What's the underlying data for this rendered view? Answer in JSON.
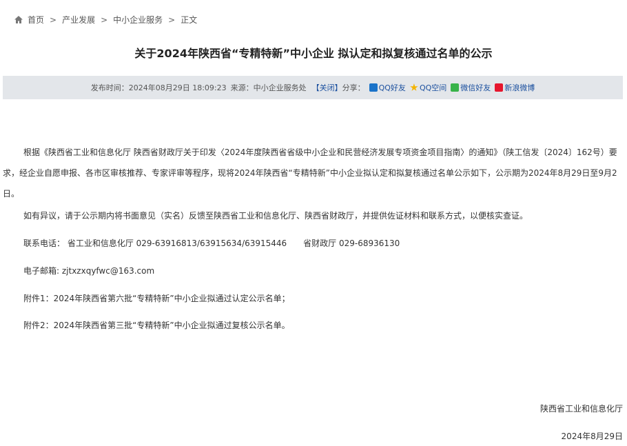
{
  "breadcrumb": {
    "items": [
      "首页",
      "产业发展",
      "中小企业服务",
      "正文"
    ],
    "separator": ">"
  },
  "title": "关于2024年陕西省“专精特新”中小企业 拟认定和拟复核通过名单的公示",
  "info": {
    "publish_label": "发布时间：",
    "publish_time": "2024年08月29日 18:09:23",
    "source_label": "来源：",
    "source": "中小企业服务处",
    "close_label": "【关闭】",
    "share_label": "分享：",
    "share": [
      "QQ好友",
      "QQ空间",
      "微信好友",
      "新浪微博"
    ]
  },
  "body": {
    "para1": "根据《陕西省工业和信息化厅 陕西省财政厅关于印发〈2024年度陕西省省级中小企业和民营经济发展专项资金项目指南〉的通知》（陕工信发〔2024〕162号）要求，经企业自愿申报、各市区审核推荐、专家评审等程序，现将2024年陕西省“专精特新”中小企业拟认定和拟复核通过名单公示如下，公示期为2024年8月29日至9月2日。",
    "para2": "如有异议，请于公示期内将书面意见（实名）反馈至陕西省工业和信息化厅、陕西省财政厅，并提供佐证材料和联系方式，以便核实查证。",
    "phone": "联系电话： 省工业和信息化厅 029-63916813/63915634/63915446　　省财政厅 029-68936130",
    "email": "电子邮箱: zjtxzxqyfwc@163.com",
    "attach1": "附件1：2024年陕西省第六批“专精特新”中小企业拟通过认定公示名单；",
    "attach2": "附件2：2024年陕西省第三批“专精特新”中小企业拟通过复核公示名单。"
  },
  "signature": {
    "org": "陕西省工业和信息化厅",
    "date": "2024年8月29日"
  },
  "colors": {
    "infobar_bg": "#e3e6ea",
    "link": "#1a4f9e"
  },
  "icons": [
    "home-icon",
    "qq-icon",
    "qzone-icon",
    "wechat-icon",
    "weibo-icon"
  ]
}
